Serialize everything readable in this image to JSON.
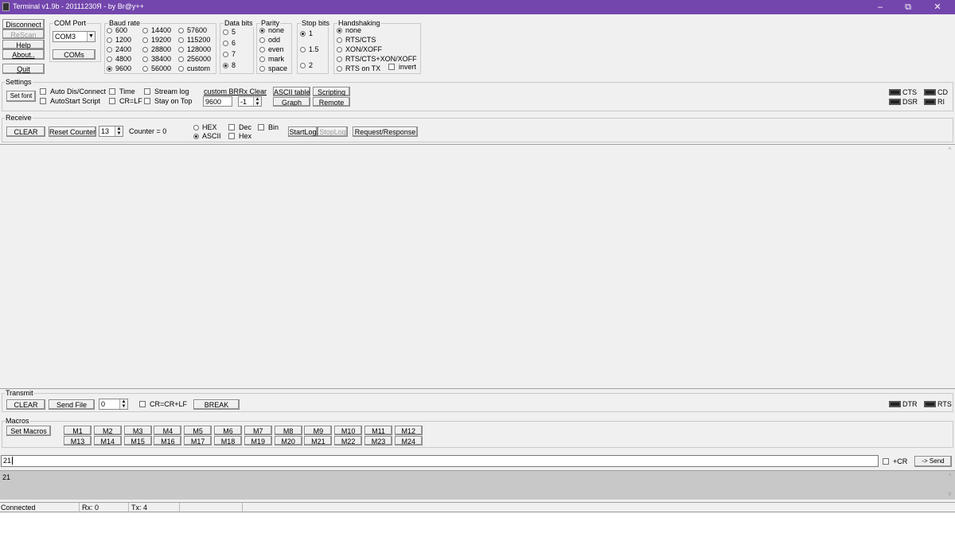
{
  "titlebar": {
    "title": "Terminal v1.9b - 20111230Я - by Br@y++",
    "minimize": "–",
    "restore": "⧉",
    "close": "✕"
  },
  "leftbuttons": {
    "disconnect": "Disconnect",
    "rescan": "ReScan",
    "help": "Help",
    "about": "About..",
    "quit": "Quit"
  },
  "comport": {
    "label": "COM Port",
    "value": "COM3",
    "coms": "COMs"
  },
  "baud": {
    "label": "Baud rate",
    "options": [
      "600",
      "1200",
      "2400",
      "4800",
      "9600",
      "14400",
      "19200",
      "28800",
      "38400",
      "56000",
      "57600",
      "115200",
      "128000",
      "256000",
      "custom"
    ],
    "selected": "9600"
  },
  "databits": {
    "label": "Data bits",
    "options": [
      "5",
      "6",
      "7",
      "8"
    ],
    "selected": "8"
  },
  "parity": {
    "label": "Parity",
    "options": [
      "none",
      "odd",
      "even",
      "mark",
      "space"
    ],
    "selected": "none"
  },
  "stopbits": {
    "label": "Stop bits",
    "options": [
      "1",
      "1.5",
      "2"
    ],
    "selected": "1"
  },
  "handshaking": {
    "label": "Handshaking",
    "options": [
      "none",
      "RTS/CTS",
      "XON/XOFF",
      "RTS/CTS+XON/XOFF",
      "RTS on TX"
    ],
    "selected": "none",
    "invert": "invert"
  },
  "settings": {
    "label": "Settings",
    "set_font": "Set font",
    "auto_dis_connect": "Auto Dis/Connect",
    "autostart_script": "AutoStart Script",
    "time": "Time",
    "cr_lf": "CR=LF",
    "stream_log": "Stream log",
    "stay_on_top": "Stay on Top",
    "custom_br_label": "custom BR",
    "custom_br_value": "9600",
    "rx_clear_label": "Rx Clear",
    "rx_clear_value": "-1",
    "ascii_table": "ASCII table",
    "scripting": "Scripting",
    "graph": "Graph",
    "remote": "Remote",
    "leds": {
      "cts": "CTS",
      "cd": "CD",
      "dsr": "DSR",
      "ri": "RI"
    }
  },
  "receive": {
    "label": "Receive",
    "clear": "CLEAR",
    "reset_counter": "Reset Counter",
    "counter_spin": "13",
    "counter": "Counter = 0",
    "hex": "HEX",
    "ascii": "ASCII",
    "mode_selected": "ASCII",
    "dec": "Dec",
    "bin": "Bin",
    "hex_chk": "Hex",
    "startlog": "StartLog",
    "stoplog": "StopLog",
    "request_response": "Request/Response"
  },
  "transmit": {
    "label": "Transmit",
    "clear": "CLEAR",
    "send_file": "Send File",
    "spin": "0",
    "cr_cr_lf": "CR=CR+LF",
    "break": "BREAK",
    "leds": {
      "dtr": "DTR",
      "rts": "RTS"
    }
  },
  "macros": {
    "label": "Macros",
    "set_macros": "Set Macros",
    "row1": [
      "M1",
      "M2",
      "M3",
      "M4",
      "M5",
      "M6",
      "M7",
      "M8",
      "M9",
      "M10",
      "M11",
      "M12"
    ],
    "row2": [
      "M13",
      "M14",
      "M15",
      "M16",
      "M17",
      "M18",
      "M19",
      "M20",
      "M21",
      "M22",
      "M23",
      "M24"
    ]
  },
  "input": {
    "value": "21",
    "cr": "+CR",
    "send": "-> Send"
  },
  "sendlog": {
    "text": "21"
  },
  "statusbar": {
    "state": "Connected",
    "rx": "Rx: 0",
    "tx": "Tx: 4"
  },
  "colors": {
    "titlebar": "#7346ad",
    "window": "#f0f0f0",
    "sendlog": "#c8c8c8"
  }
}
